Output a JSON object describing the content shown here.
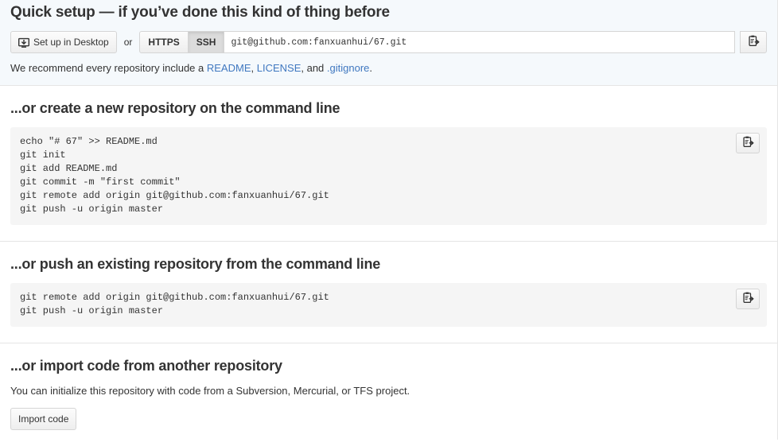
{
  "quick_setup": {
    "title": "Quick setup — if you’ve done this kind of thing before",
    "desktop_button_label": "Set up in Desktop",
    "desktop_icon": "desktop-download-icon",
    "or_label": "or",
    "protocols": [
      {
        "label": "HTTPS",
        "selected": false
      },
      {
        "label": "SSH",
        "selected": true
      }
    ],
    "clone_url": "git@github.com:fanxuanhui/67.git",
    "copy_icon": "clipboard-copy-icon",
    "recommend_prefix": "We recommend every repository include a ",
    "recommend_link_readme": "README",
    "recommend_sep1": ", ",
    "recommend_link_license": "LICENSE",
    "recommend_sep2": ", and ",
    "recommend_link_gitignore": ".gitignore",
    "recommend_suffix": "."
  },
  "create_section": {
    "title": "...or create a new repository on the command line",
    "code": "echo \"# 67\" >> README.md\ngit init\ngit add README.md\ngit commit -m \"first commit\"\ngit remote add origin git@github.com:fanxuanhui/67.git\ngit push -u origin master",
    "copy_icon": "clipboard-copy-icon"
  },
  "push_section": {
    "title": "...or push an existing repository from the command line",
    "code": "git remote add origin git@github.com:fanxuanhui/67.git\ngit push -u origin master",
    "copy_icon": "clipboard-copy-icon"
  },
  "import_section": {
    "title": "...or import code from another repository",
    "description": "You can initialize this repository with code from a Subversion, Mercurial, or TFS project.",
    "button_label": "Import code"
  },
  "colors": {
    "link": "#4078c0",
    "quick_setup_bg": "#f5f9fc",
    "code_bg": "#f5f5f5",
    "border": "#e5e5e5",
    "selected_toggle": "#dcdcdc"
  }
}
